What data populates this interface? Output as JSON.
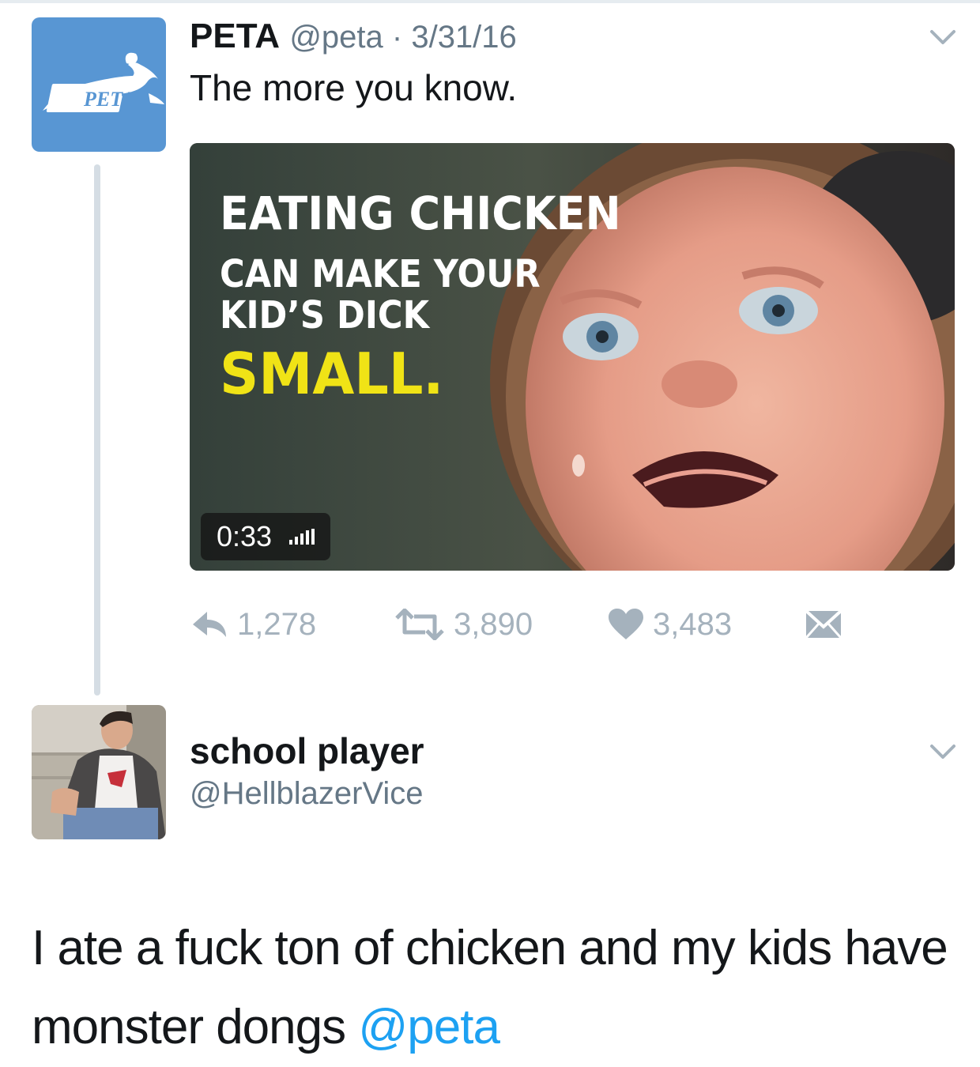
{
  "colors": {
    "text": "#14171a",
    "muted": "#657786",
    "action": "#a5b2bd",
    "link": "#1da1f2",
    "peta_blue": "#5896d3",
    "headline_yellow": "#f0e316"
  },
  "tweet": {
    "avatar": {
      "logo_text": "PETA",
      "icon": "peta-rabbit-logo"
    },
    "author_name": "PETA",
    "meta": "@peta · 3/31/16",
    "text": "The more you know.",
    "menu_icon": "chevron-down-icon",
    "media": {
      "headline_line1": "EATING CHICKEN",
      "headline_line2": "CAN MAKE YOUR",
      "headline_line3": "KID’S DICK",
      "headline_line4": "SMALL.",
      "duration": "0:33",
      "volume_icon": "volume-icon"
    },
    "actions": {
      "reply": {
        "icon": "reply-icon",
        "count": "1,278"
      },
      "retweet": {
        "icon": "retweet-icon",
        "count": "3,890"
      },
      "like": {
        "icon": "heart-icon",
        "count": "3,483"
      },
      "dm": {
        "icon": "envelope-icon"
      }
    }
  },
  "reply": {
    "author_name": "school player",
    "handle": "@HellblazerVice",
    "menu_icon": "chevron-down-icon",
    "text": "I ate a fuck ton of chicken and my kids have monster dongs",
    "mention": "@peta"
  }
}
